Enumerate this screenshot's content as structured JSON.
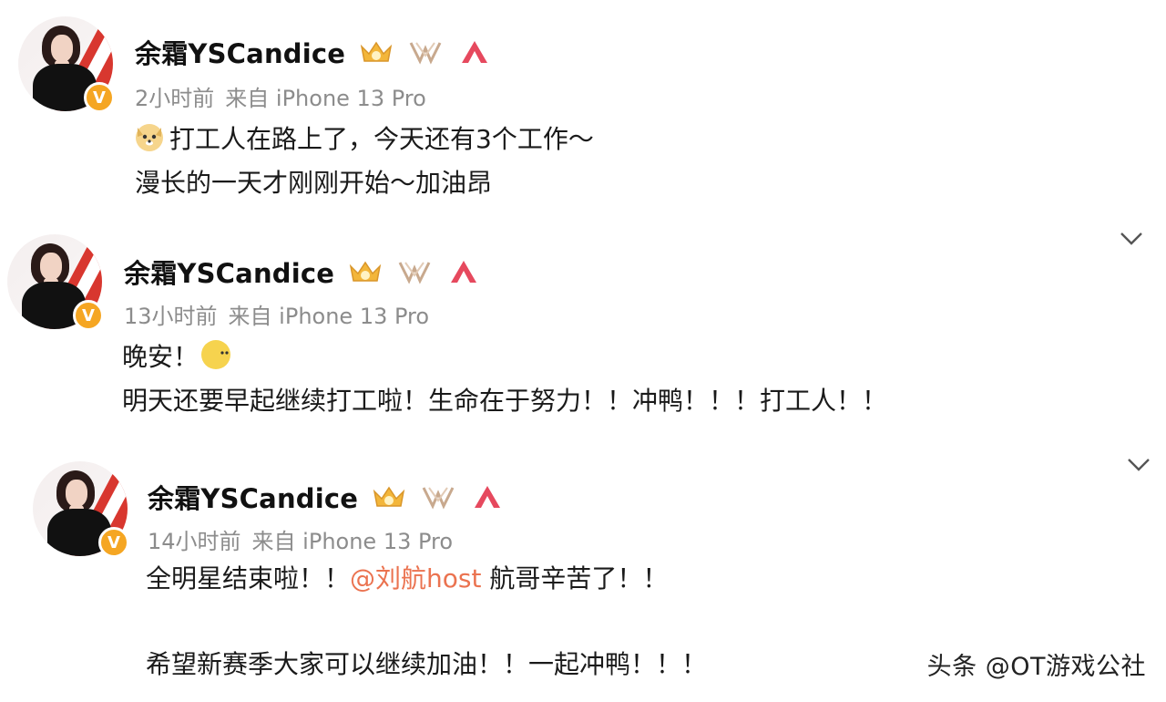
{
  "posts": [
    {
      "username": "余霜YSCandice",
      "time": "2小时前",
      "source": "来自 iPhone 13 Pro",
      "lines": [
        "打工人在路上了，今天还有3个工作～",
        "漫长的一天才刚刚开始～加油昂"
      ],
      "emoji": "dog-face-emoji"
    },
    {
      "username": "余霜YSCandice",
      "time": "13小时前",
      "source": "来自 iPhone 13 Pro",
      "lines": [
        "晚安！",
        "明天还要早起继续打工啦！生命在于努力！！冲鸭！！！打工人！！"
      ],
      "emoji": "moon-emoji"
    },
    {
      "username": "余霜YSCandice",
      "time": "14小时前",
      "source": "来自 iPhone 13 Pro",
      "line1_prefix": "全明星结束啦！！",
      "mention": "@刘航host",
      "line1_suffix": " 航哥辛苦了！！",
      "line2": "希望新赛季大家可以继续加油！！一起冲鸭！！！"
    }
  ],
  "badge_letter": "V",
  "watermark": "头条 @OT游戏公社",
  "colors": {
    "mention": "#eb7350",
    "verified": "#f5a623",
    "meta": "#8c8c8c"
  },
  "icons": [
    "crown-icon",
    "vgv-icon",
    "member-icon",
    "chevron-down-icon"
  ]
}
